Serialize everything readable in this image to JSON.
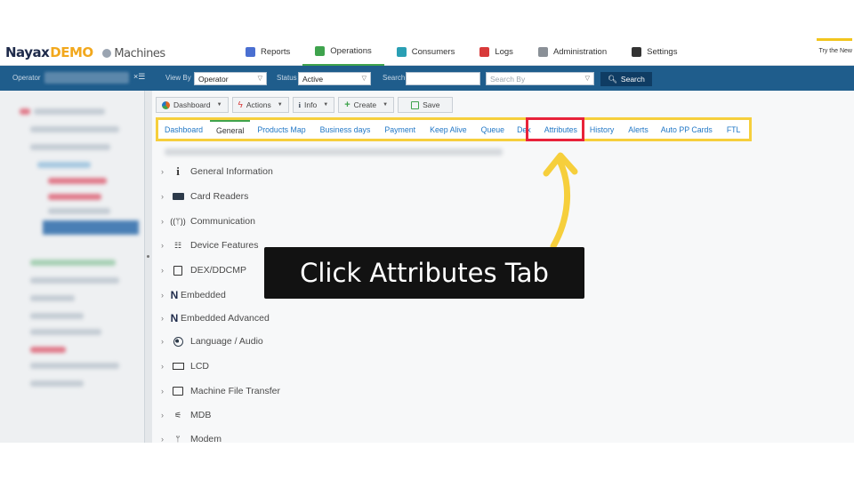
{
  "brand": {
    "name": "Nayax",
    "demo": "DEMO",
    "section": "Machines"
  },
  "nav": [
    {
      "label": "Reports",
      "color": "#4a6fd1",
      "active": false
    },
    {
      "label": "Operations",
      "color": "#3fa34d",
      "active": true
    },
    {
      "label": "Consumers",
      "color": "#2a9fb4",
      "active": false
    },
    {
      "label": "Logs",
      "color": "#d83a3a",
      "active": false
    },
    {
      "label": "Administration",
      "color": "#8a9097",
      "active": false
    },
    {
      "label": "Settings",
      "color": "#333333",
      "active": false
    }
  ],
  "try_text": "Try the New",
  "filter": {
    "operator_label": "Operator",
    "clear_icon": "x-list-icon",
    "view_by_label": "View By",
    "view_by_value": "Operator",
    "status_label": "Status",
    "status_value": "Active",
    "search_label": "Search",
    "search_by_placeholder": "Search By",
    "search_button": "Search"
  },
  "toolbar": [
    {
      "label": "Dashboard",
      "icon": "chart-icon",
      "color": "#e0661f",
      "caret": true
    },
    {
      "label": "Actions",
      "icon": "lightning-icon",
      "color": "#d83a3a",
      "caret": true
    },
    {
      "label": "Info",
      "icon": "info-icon",
      "color": "#2d3a4a",
      "caret": true
    },
    {
      "label": "Create",
      "icon": "plus-icon",
      "color": "#3fa34d",
      "caret": true
    },
    {
      "label": "Save",
      "icon": "save-icon",
      "color": "#3fa34d",
      "caret": false
    }
  ],
  "tabs": [
    {
      "label": "Dashboard"
    },
    {
      "label": "General",
      "active": true
    },
    {
      "label": "Products Map"
    },
    {
      "label": "Business days"
    },
    {
      "label": "Payment"
    },
    {
      "label": "Keep Alive"
    },
    {
      "label": "Queue"
    },
    {
      "label": "Dex"
    },
    {
      "label": "Attributes",
      "highlighted": true
    },
    {
      "label": "History"
    },
    {
      "label": "Alerts"
    },
    {
      "label": "Auto PP Cards"
    },
    {
      "label": "FTL"
    }
  ],
  "sections": [
    {
      "label": "General Information",
      "icon": "info-icon"
    },
    {
      "label": "Card Readers",
      "icon": "card-reader-icon"
    },
    {
      "label": "Communication",
      "icon": "antenna-icon"
    },
    {
      "label": "Device Features",
      "icon": "features-icon"
    },
    {
      "label": "DEX/DDCMP",
      "icon": "dex-icon"
    },
    {
      "label": "Embedded",
      "icon": "n-logo-icon"
    },
    {
      "label": "Embedded Advanced",
      "icon": "n-logo-icon"
    },
    {
      "label": "Language / Audio",
      "icon": "globe-icon"
    },
    {
      "label": "LCD",
      "icon": "lcd-icon"
    },
    {
      "label": "Machine File Transfer",
      "icon": "file-transfer-icon"
    },
    {
      "label": "MDB",
      "icon": "mdb-icon"
    },
    {
      "label": "Modem",
      "icon": "modem-icon"
    }
  ],
  "callout": {
    "text": "Click Attributes Tab"
  },
  "colors": {
    "highlight": "#f6cf3c",
    "marker": "#e8233a",
    "arrow": "#f6cf3c",
    "filterbar": "#1f5d8c",
    "link": "#2278c6"
  }
}
